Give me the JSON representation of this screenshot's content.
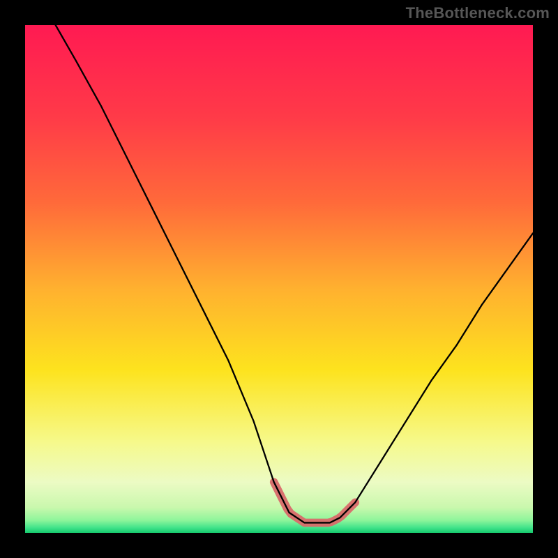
{
  "watermark": "TheBottleneck.com",
  "chart_data": {
    "type": "line",
    "title": "",
    "xlabel": "",
    "ylabel": "",
    "xlim": [
      0,
      100
    ],
    "ylim": [
      0,
      100
    ],
    "series": [
      {
        "name": "bottleneck-curve",
        "x": [
          6,
          10,
          15,
          20,
          25,
          30,
          35,
          40,
          45,
          49,
          52,
          55,
          58,
          60,
          62,
          65,
          70,
          75,
          80,
          85,
          90,
          95,
          100
        ],
        "values": [
          100,
          93,
          84,
          74,
          64,
          54,
          44,
          34,
          22,
          10,
          4,
          2,
          2,
          2,
          3,
          6,
          14,
          22,
          30,
          37,
          45,
          52,
          59
        ]
      }
    ],
    "highlight_region": {
      "name": "optimal-zone",
      "color": "#d96a6a",
      "x_range": [
        49,
        65
      ],
      "y_range": [
        0.5,
        10
      ]
    },
    "background": {
      "type": "vertical-gradient",
      "stops": [
        {
          "offset": 0.0,
          "color": "#ff1a52"
        },
        {
          "offset": 0.18,
          "color": "#ff3a48"
        },
        {
          "offset": 0.35,
          "color": "#ff6a3a"
        },
        {
          "offset": 0.52,
          "color": "#ffb12f"
        },
        {
          "offset": 0.68,
          "color": "#fde31e"
        },
        {
          "offset": 0.82,
          "color": "#f6f98a"
        },
        {
          "offset": 0.9,
          "color": "#ecfbc4"
        },
        {
          "offset": 0.95,
          "color": "#c9f8ad"
        },
        {
          "offset": 0.975,
          "color": "#8ef59b"
        },
        {
          "offset": 0.99,
          "color": "#3fe38a"
        },
        {
          "offset": 1.0,
          "color": "#16c96d"
        }
      ]
    }
  }
}
